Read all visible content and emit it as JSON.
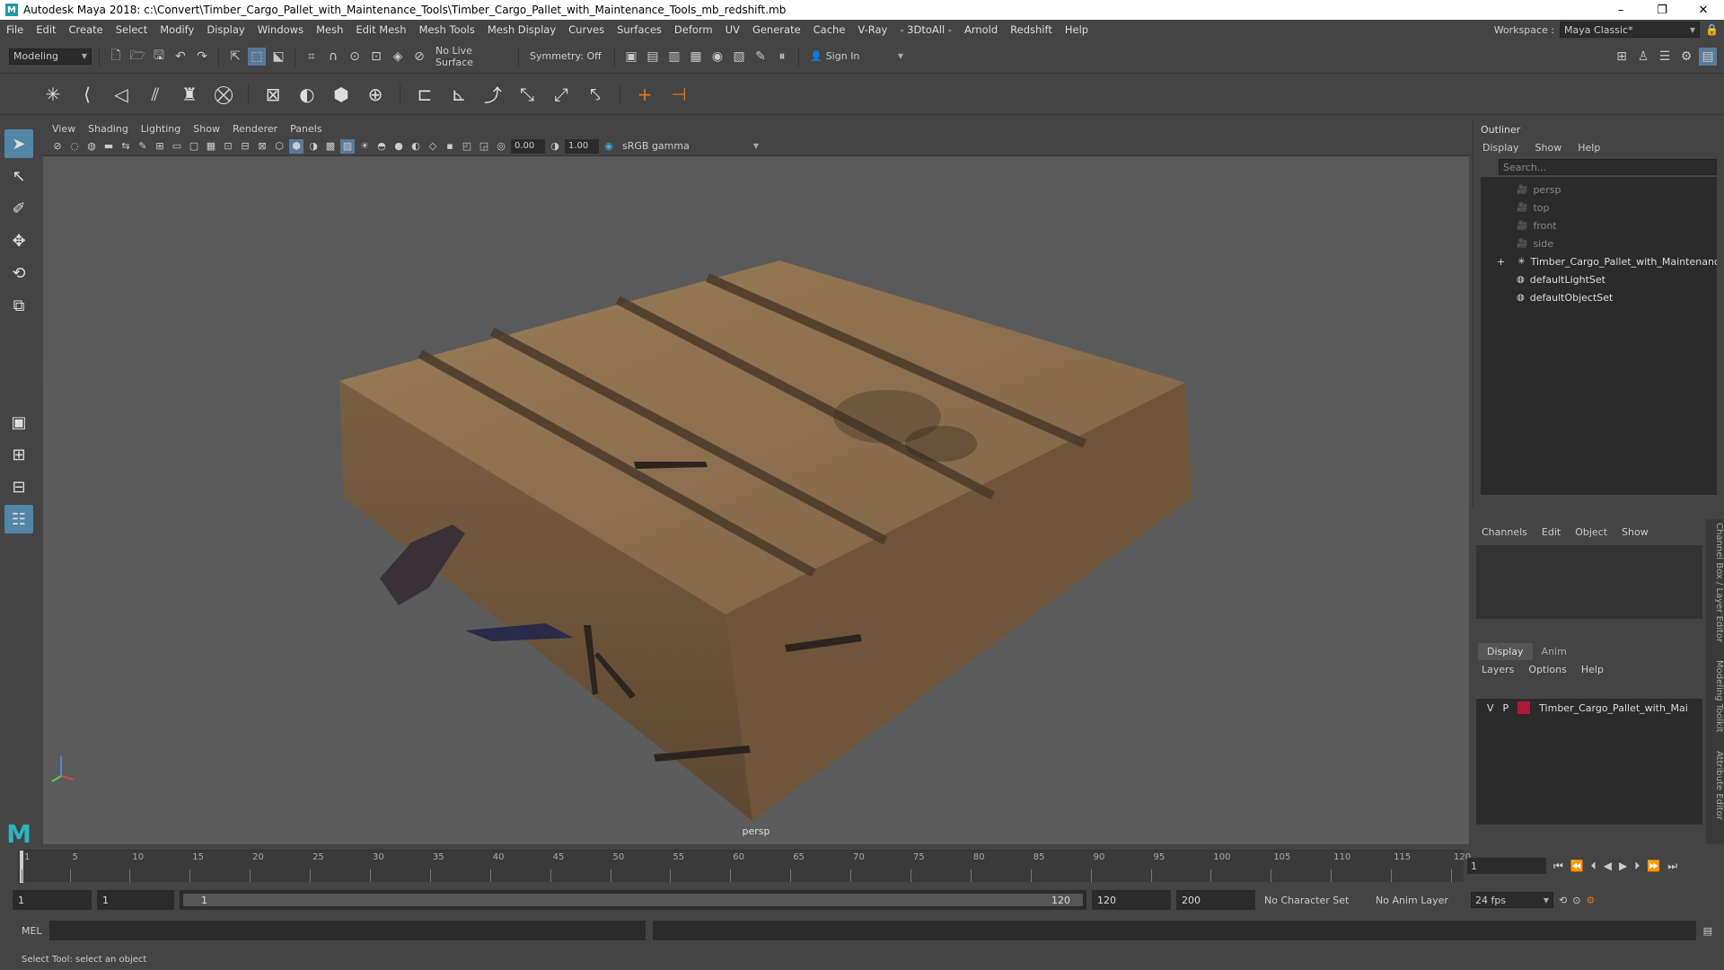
{
  "app": {
    "title": "Autodesk Maya 2018: c:\\Convert\\Timber_Cargo_Pallet_with_Maintenance_Tools\\Timber_Cargo_Pallet_with_Maintenance_Tools_mb_redshift.mb",
    "logo": "M",
    "minimize": "–",
    "restore": "❐",
    "close": "✕"
  },
  "menubar": {
    "items": [
      "File",
      "Edit",
      "Create",
      "Select",
      "Modify",
      "Display",
      "Windows",
      "Mesh",
      "Edit Mesh",
      "Mesh Tools",
      "Mesh Display",
      "Curves",
      "Surfaces",
      "Deform",
      "UV",
      "Generate",
      "Cache",
      "V-Ray",
      "- 3DtoAll -",
      "Arnold",
      "Redshift",
      "Help"
    ],
    "workspace_label": "Workspace :",
    "workspace_value": "Maya Classic*"
  },
  "statusline": {
    "mode": "Modeling",
    "live_surface": "No Live Surface",
    "symmetry": "Symmetry: Off",
    "sign_in": "Sign In"
  },
  "panel": {
    "menus": [
      "View",
      "Shading",
      "Lighting",
      "Show",
      "Renderer",
      "Panels"
    ],
    "exposure": "0.00",
    "gamma": "1.00",
    "color_space": "sRGB gamma",
    "camera_label": "persp"
  },
  "outliner": {
    "title": "Outliner",
    "menus": [
      "Display",
      "Show",
      "Help"
    ],
    "search_placeholder": "Search...",
    "items": [
      {
        "label": "persp",
        "icon": "camera-icon",
        "dim": true
      },
      {
        "label": "top",
        "icon": "camera-icon",
        "dim": true
      },
      {
        "label": "front",
        "icon": "camera-icon",
        "dim": true
      },
      {
        "label": "side",
        "icon": "camera-icon",
        "dim": true
      },
      {
        "label": "Timber_Cargo_Pallet_with_Maintenance_",
        "icon": "transform-icon",
        "dim": false,
        "expand": "+"
      },
      {
        "label": "defaultLightSet",
        "icon": "set-icon",
        "dim": false
      },
      {
        "label": "defaultObjectSet",
        "icon": "set-icon",
        "dim": false
      }
    ]
  },
  "channelbox": {
    "menus": [
      "Channels",
      "Edit",
      "Object",
      "Show"
    ],
    "side_tabs": [
      "Channel Box / Layer Editor",
      "Modeling Toolkit",
      "Attribute Editor"
    ]
  },
  "layers": {
    "tabs": [
      "Display",
      "Anim"
    ],
    "menus": [
      "Layers",
      "Options",
      "Help"
    ],
    "row": {
      "v": "V",
      "p": "P",
      "name": "Timber_Cargo_Pallet_with_Mai",
      "color": "#b0163a"
    }
  },
  "timeslider": {
    "ticks": [
      "1",
      "5",
      "10",
      "15",
      "20",
      "25",
      "30",
      "35",
      "40",
      "45",
      "50",
      "55",
      "60",
      "65",
      "70",
      "75",
      "80",
      "85",
      "90",
      "95",
      "100",
      "105",
      "110",
      "115",
      "120"
    ],
    "current_frame": "1"
  },
  "range": {
    "start": "1",
    "anim_start": "1",
    "slider_start": "1",
    "slider_end": "120",
    "anim_end": "120",
    "end": "200",
    "character_set": "No Character Set",
    "anim_layer": "No Anim Layer",
    "fps": "24 fps"
  },
  "cmdline": {
    "lang": "MEL"
  },
  "helpline": {
    "text": "Select Tool: select an object"
  }
}
